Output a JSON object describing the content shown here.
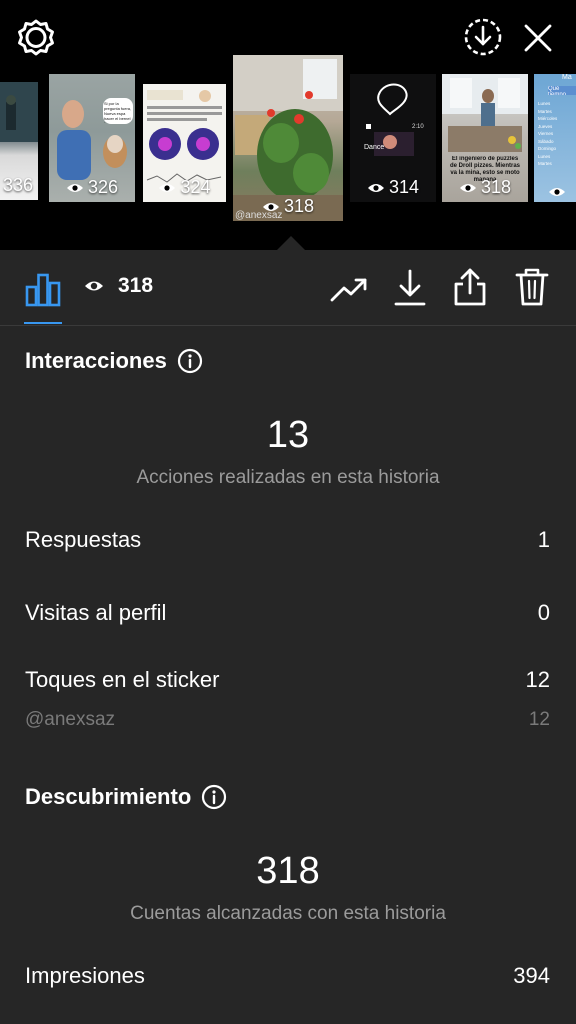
{
  "stories": [
    {
      "views": "336"
    },
    {
      "views": "326"
    },
    {
      "views": "324"
    },
    {
      "views": "318",
      "handle": "@anexsaz"
    },
    {
      "views": "314"
    },
    {
      "views": "318"
    },
    {
      "views": ""
    }
  ],
  "story_texts": {
    "t2_bubble": "Si por la pregunta fuera, Nueva espa hacer el bernel femeno...",
    "t5_dance": "Dance",
    "t5_time": "2:10",
    "t6_caption": "El ingeniero de puzzles de Droll pizzes. Mientras va la mina, esto se moto manana",
    "t7_header": "Ma",
    "t7_title": "Qué tiempo...",
    "t7_days": [
      "Lunes",
      "Martes",
      "Miércoles",
      "Jueves",
      "Viernes",
      "Sábado",
      "Domingo",
      "Lunes",
      "Martes"
    ]
  },
  "toolbar": {
    "current_views": "318"
  },
  "interacciones": {
    "title": "Interacciones",
    "total": "13",
    "caption": "Acciones realizadas en esta historia",
    "rows": [
      {
        "label": "Respuestas",
        "value": "1"
      },
      {
        "label": "Visitas al perfil",
        "value": "0"
      },
      {
        "label": "Toques en el sticker",
        "value": "12"
      }
    ],
    "sticker_sub": {
      "label": "@anexsaz",
      "value": "12"
    }
  },
  "descubrimiento": {
    "title": "Descubrimiento",
    "total": "318",
    "caption": "Cuentas alcanzadas con esta historia",
    "rows": [
      {
        "label": "Impresiones",
        "value": "394"
      }
    ]
  },
  "colors": {
    "background": "#262626",
    "top": "#000000",
    "accent": "#3897f0",
    "muted": "#9b9b9b"
  }
}
